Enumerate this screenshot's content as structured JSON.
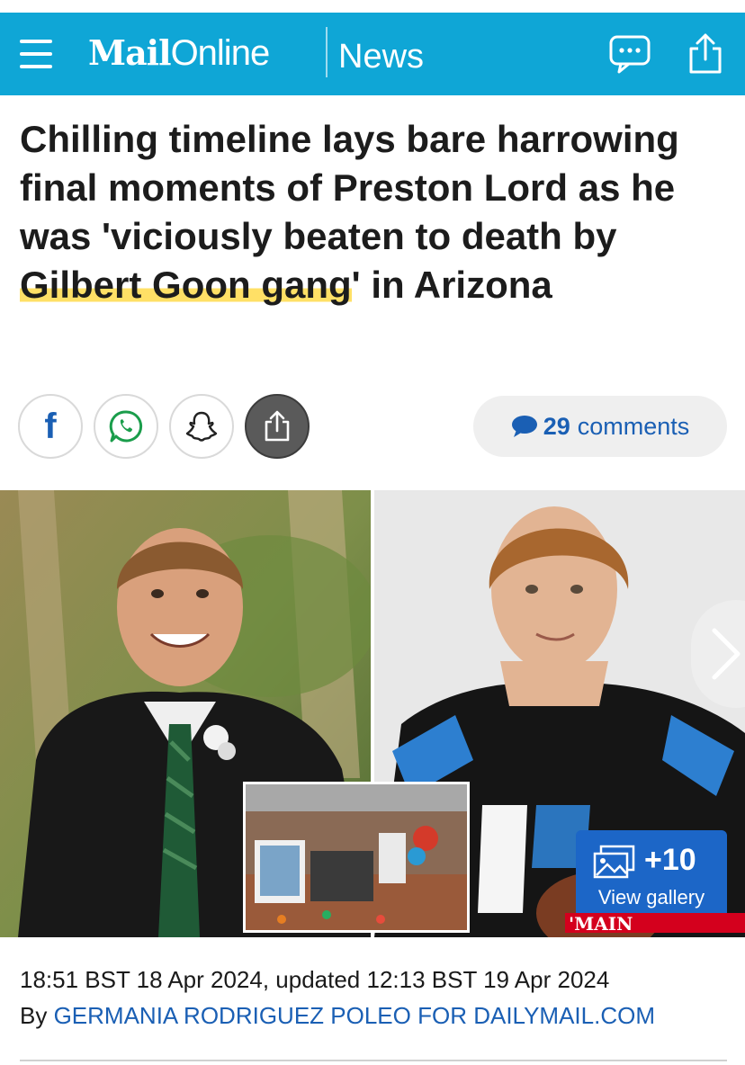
{
  "header": {
    "logo_mail": "Mail",
    "logo_online": "Online",
    "section": "News",
    "background_color": "#0fa6d6"
  },
  "icons": {
    "menu": "hamburger-menu-icon",
    "chat": "chat-bubble-icon",
    "share": "share-icon",
    "facebook": "facebook-icon",
    "whatsapp": "whatsapp-icon",
    "snapchat": "snapchat-icon"
  },
  "headline": {
    "part1": "Chilling timeline lays bare harrowing final moments of Preston Lord as he was 'viciously beaten to death by ",
    "highlight": "Gilbert Goon gang",
    "part2": "' in Arizona"
  },
  "share": {
    "facebook_label": "f",
    "comments_count": "29",
    "comments_label": "comments"
  },
  "image": {
    "gallery_count": "+10",
    "gallery_label": "View gallery",
    "caption_tag": "'MAIN ATTACKER'"
  },
  "meta": {
    "published": "18:51 BST 18 Apr 2024, updated 12:13 BST 19 Apr 2024",
    "by_prefix": "By",
    "author": "GERMANIA RODRIGUEZ POLEO FOR DAILYMAIL.COM"
  }
}
